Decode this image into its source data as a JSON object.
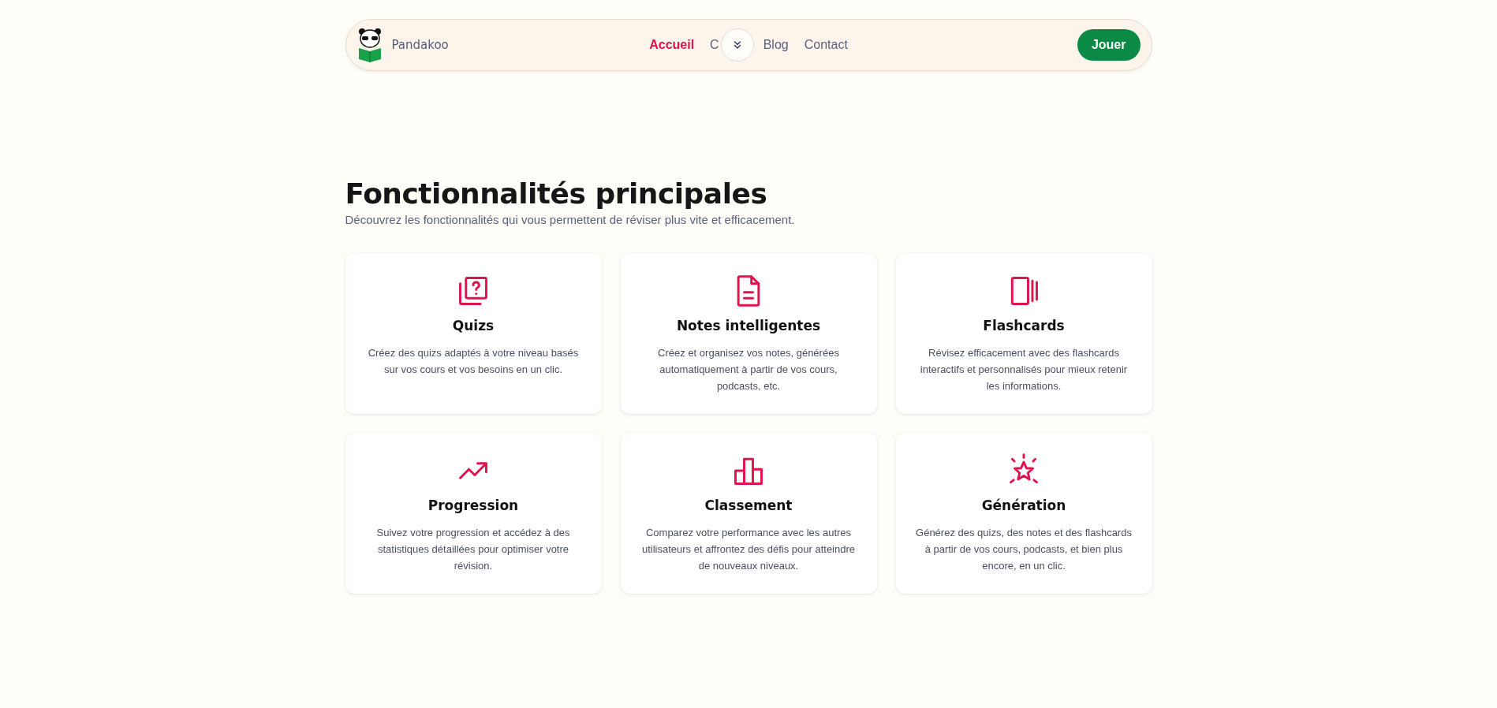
{
  "header": {
    "brand": "Pandakoo",
    "nav": [
      {
        "label": "Accueil",
        "selected": true
      },
      {
        "label": "C",
        "selected": false
      },
      {
        "label": "Blog",
        "selected": false
      },
      {
        "label": "Contact",
        "selected": false
      }
    ],
    "cta": "Jouer"
  },
  "section": {
    "title": "Fonctionnalités principales",
    "subtitle": "Découvrez les fonctionnalités qui vous permettent de réviser plus vite et efficacement.",
    "features": [
      {
        "title": "Quizs",
        "text": "Créez des quizs adaptés à votre niveau basés sur vos cours et vos besoins en un clic."
      },
      {
        "title": "Notes intelligentes",
        "text": "Créez et organisez vos notes, générées automatiquement à partir de vos cours, podcasts, etc."
      },
      {
        "title": "Flashcards",
        "text": "Révisez efficacement avec des flashcards interactifs et personnalisés pour mieux retenir les informations."
      },
      {
        "title": "Progression",
        "text": "Suivez votre progression et accédez à des statistiques détaillées pour optimiser votre révision."
      },
      {
        "title": "Classement",
        "text": "Comparez votre performance avec les autres utilisateurs et affrontez des défis pour atteindre de nouveaux niveaux."
      },
      {
        "title": "Génération",
        "text": "Générez des quizs, des notes et des flashcards à partir de vos cours, podcasts, et bien plus encore, en un clic."
      }
    ]
  }
}
